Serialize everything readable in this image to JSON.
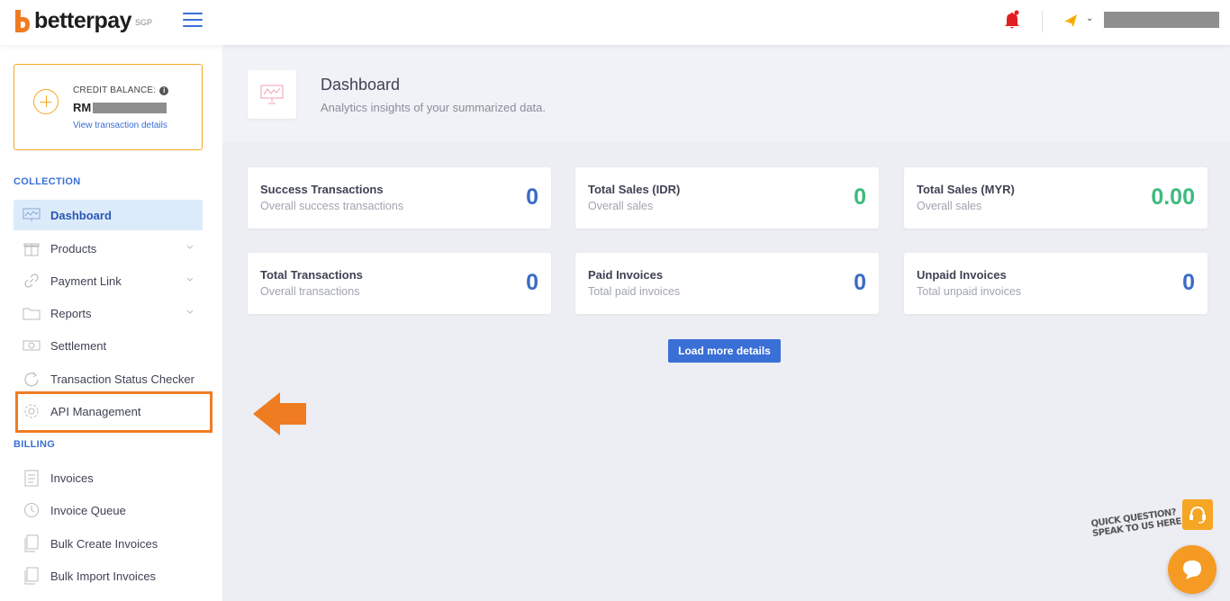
{
  "header": {
    "brand": "betterpay",
    "brand_suffix": "SGP"
  },
  "credit": {
    "label": "CREDIT BALANCE:",
    "currency": "RM",
    "link": "View transaction details"
  },
  "sidebar": {
    "sections": {
      "collection": "COLLECTION",
      "billing": "BILLING"
    },
    "items": [
      {
        "label": "Dashboard",
        "icon": "presentation-chart-icon",
        "active": true
      },
      {
        "label": "Products",
        "icon": "gift-box-icon"
      },
      {
        "label": "Payment Link",
        "icon": "link-icon"
      },
      {
        "label": "Reports",
        "icon": "folder-icon"
      },
      {
        "label": "Settlement",
        "icon": "cash-icon"
      },
      {
        "label": "Transaction Status Checker",
        "icon": "refresh-icon"
      },
      {
        "label": "API Management",
        "icon": "gear-icon",
        "highlighted": true
      },
      {
        "label": "Invoices",
        "icon": "clipboard-icon"
      },
      {
        "label": "Invoice Queue",
        "icon": "clock-icon"
      },
      {
        "label": "Bulk Create Invoices",
        "icon": "documents-icon"
      },
      {
        "label": "Bulk Import Invoices",
        "icon": "documents-icon"
      }
    ]
  },
  "page": {
    "title": "Dashboard",
    "subtitle": "Analytics insights of your summarized data."
  },
  "cards": [
    {
      "title": "Success Transactions",
      "subtitle": "Overall success transactions",
      "value": "0",
      "color": "#3a6cc4"
    },
    {
      "title": "Total Sales (IDR)",
      "subtitle": "Overall sales",
      "value": "0",
      "color": "#3dbb7d"
    },
    {
      "title": "Total Sales (MYR)",
      "subtitle": "Overall sales",
      "value": "0.00",
      "color": "#3dbb7d"
    },
    {
      "title": "Total Transactions",
      "subtitle": "Overall transactions",
      "value": "0",
      "color": "#3a6cc4"
    },
    {
      "title": "Paid Invoices",
      "subtitle": "Total paid invoices",
      "value": "0",
      "color": "#3a6cc4"
    },
    {
      "title": "Unpaid Invoices",
      "subtitle": "Total unpaid invoices",
      "value": "0",
      "color": "#3a6cc4"
    }
  ],
  "load_more": "Load more details",
  "help": {
    "line1": "QUICK QUESTION?",
    "line2": "SPEAK TO US HERE!"
  },
  "colors": {
    "brand_orange": "#f5a623",
    "accent_blue": "#3a6fd6",
    "highlight": "#f07c22"
  }
}
